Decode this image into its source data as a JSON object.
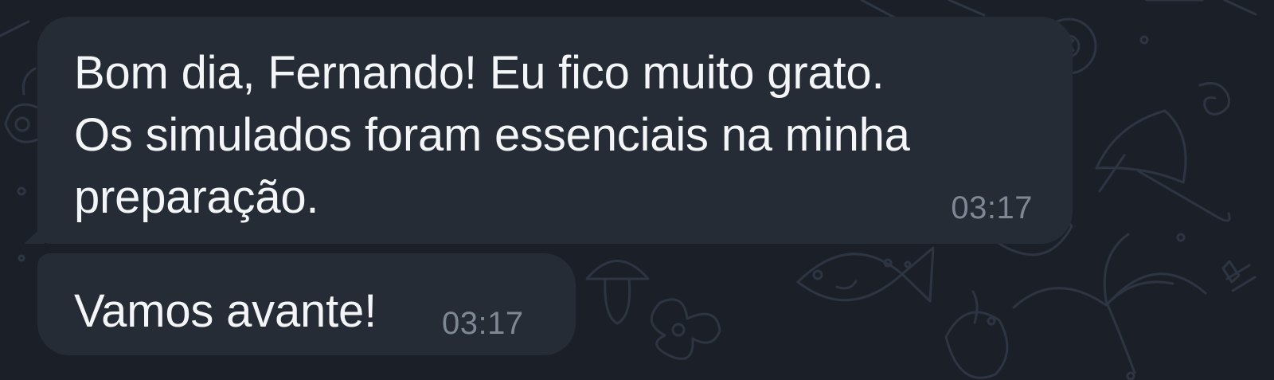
{
  "chat": {
    "messages": [
      {
        "text": "Bom dia, Fernando! Eu fico muito grato.\nOs simulados foram essenciais na minha\npreparação.",
        "time": "03:17"
      },
      {
        "text": "Vamos avante!",
        "time": "03:17"
      }
    ]
  },
  "colors": {
    "background": "#1b2028",
    "bubble": "#252c36",
    "text": "#f3f5f7",
    "timestamp": "#7d8894",
    "doodles": "#303846"
  },
  "background_pattern": {
    "icons": [
      "umbrella-icon",
      "billiard-ball-icon",
      "fish-icon",
      "palm-tree-icon",
      "candy-icon",
      "flower-icon",
      "whistle-icon"
    ]
  }
}
